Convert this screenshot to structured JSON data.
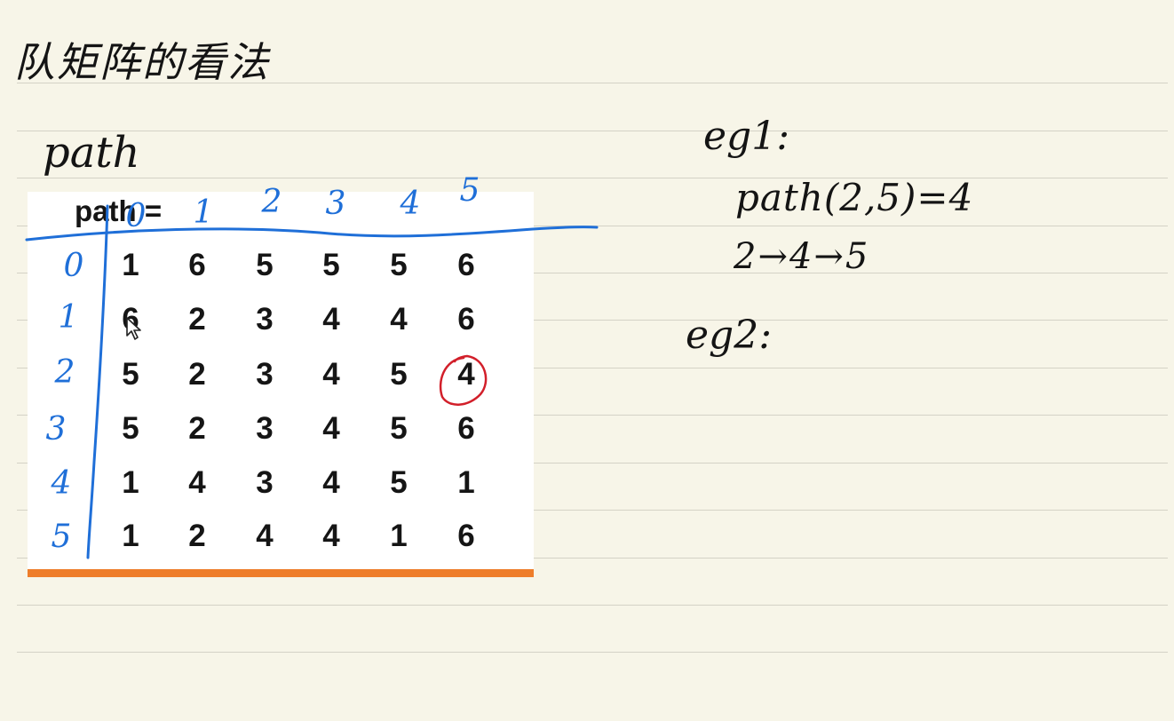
{
  "page": {
    "title": "队矩阵的看法",
    "section_label": "path",
    "examples": [
      {
        "label": "eg1:",
        "lines": [
          "path(2,5)=4",
          "2→4→5"
        ]
      },
      {
        "label": "eg2:",
        "lines": []
      }
    ]
  },
  "matrix": {
    "title": "path =",
    "col_labels": [
      "0",
      "1",
      "2",
      "3",
      "4",
      "5"
    ],
    "row_labels": [
      "0",
      "1",
      "2",
      "3",
      "4",
      "5"
    ],
    "rows": [
      [
        "1",
        "6",
        "5",
        "5",
        "5",
        "6"
      ],
      [
        "6",
        "2",
        "3",
        "4",
        "4",
        "6"
      ],
      [
        "5",
        "2",
        "3",
        "4",
        "5",
        "4"
      ],
      [
        "5",
        "2",
        "3",
        "4",
        "5",
        "6"
      ],
      [
        "1",
        "4",
        "3",
        "4",
        "5",
        "1"
      ],
      [
        "1",
        "2",
        "4",
        "4",
        "1",
        "6"
      ]
    ],
    "highlight": {
      "row": 2,
      "col": 5,
      "color": "#d21f2a"
    }
  },
  "colors": {
    "paper": "#f7f5e8",
    "rule_line": "#d4d2c6",
    "ink_blue": "#1f6fd8",
    "ink_red": "#d21f2a",
    "accent_bar": "#ee7d2a"
  },
  "icons": [
    "mouse-pointer-icon"
  ]
}
